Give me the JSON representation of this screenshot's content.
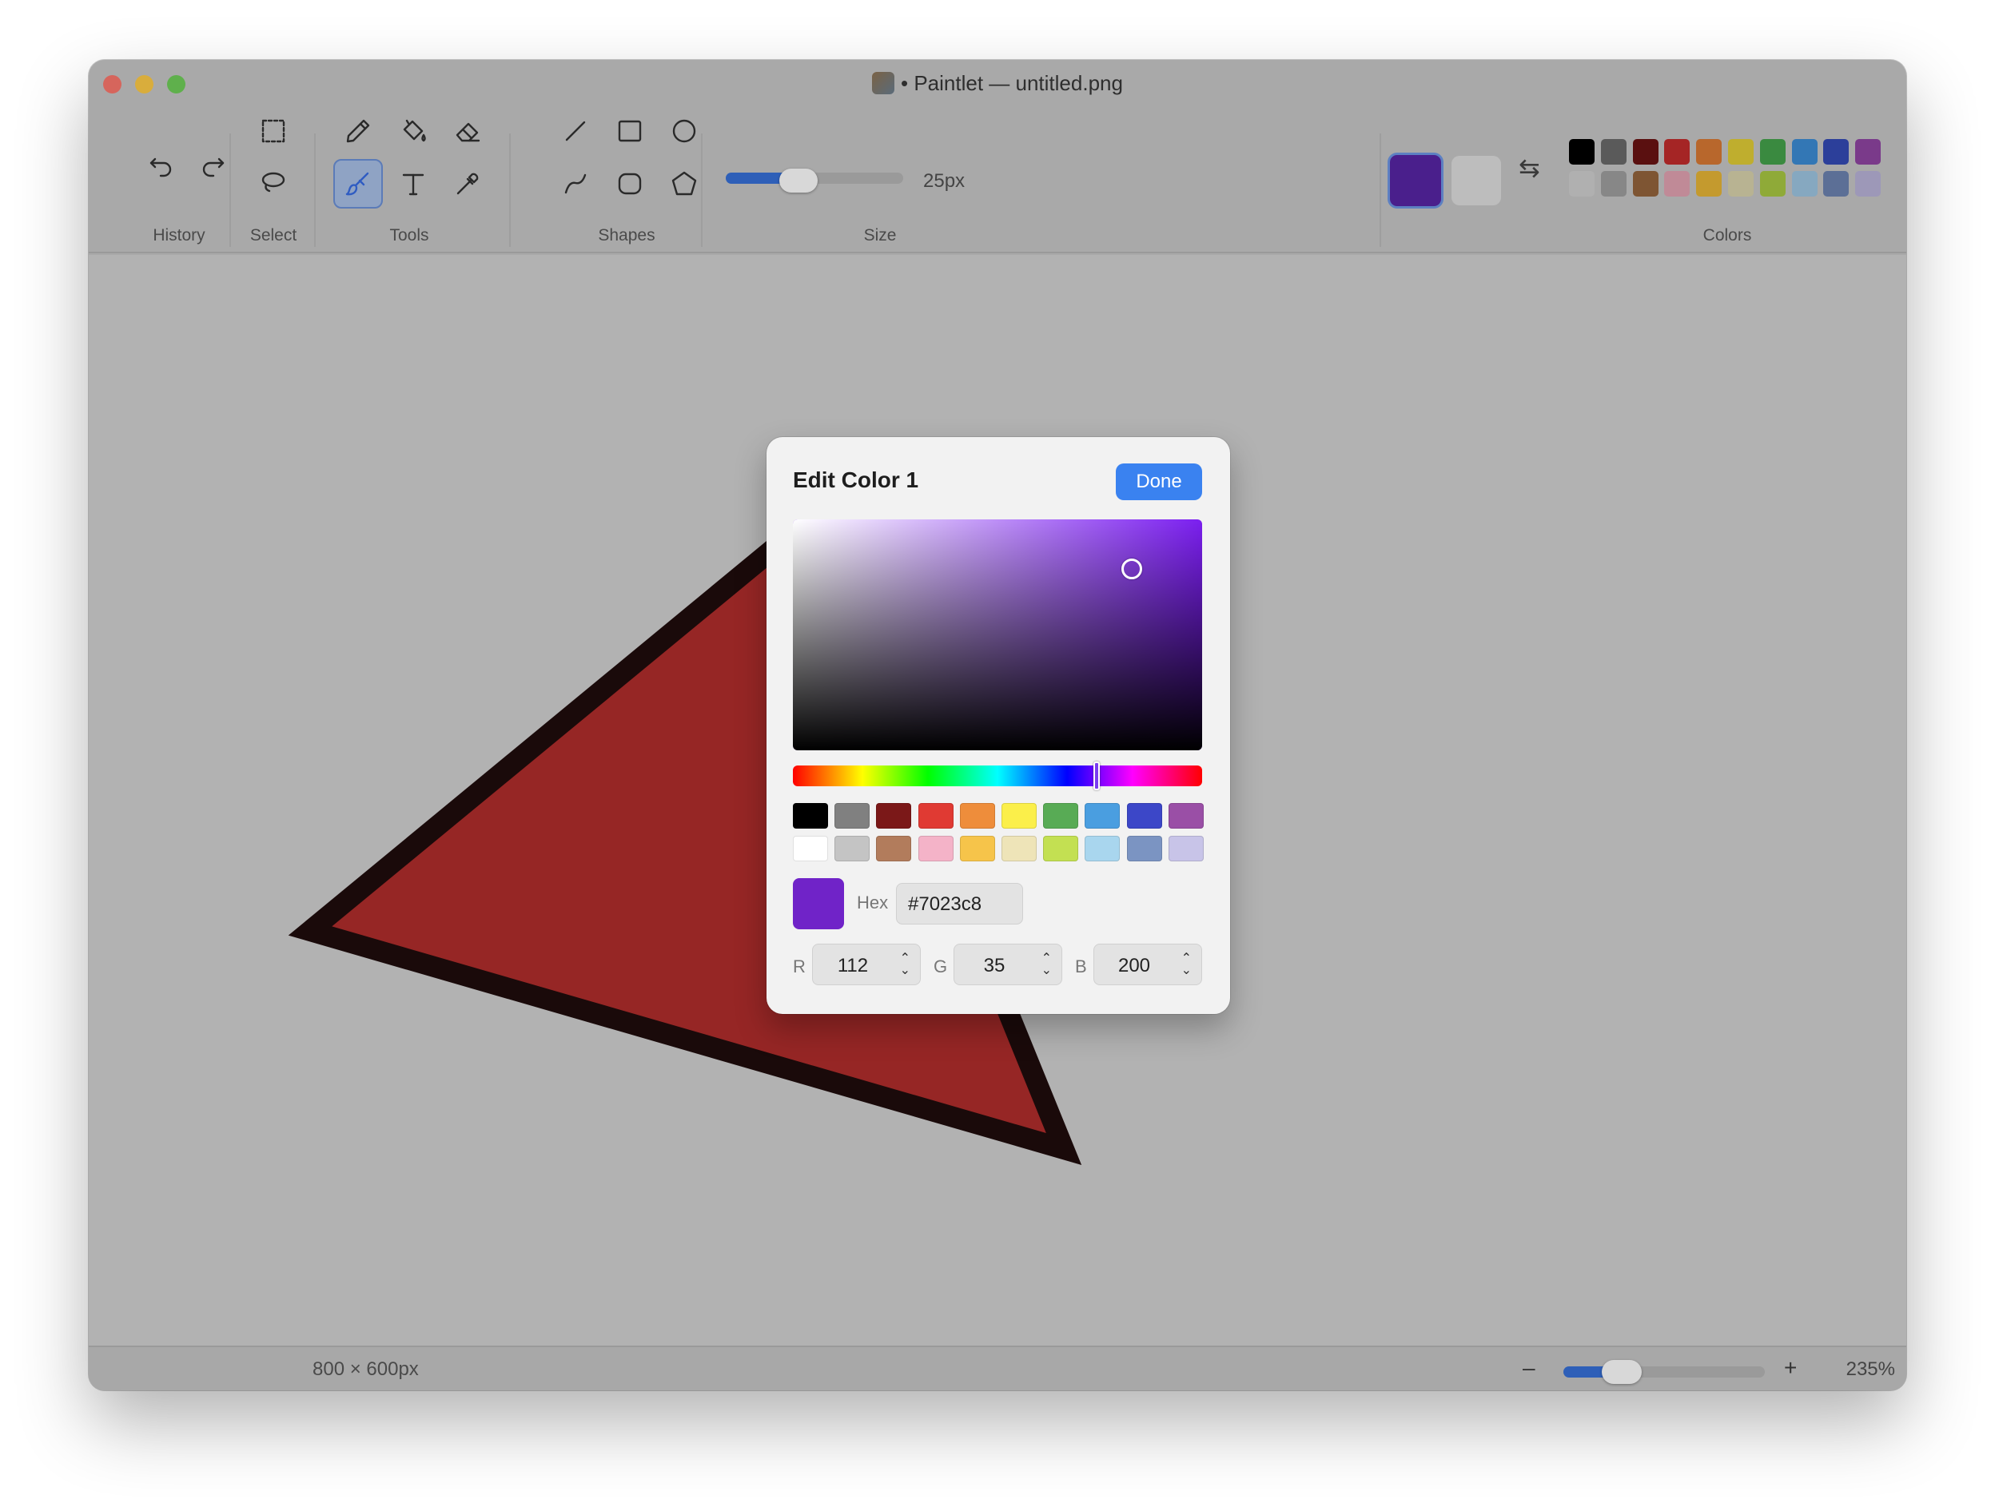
{
  "window": {
    "title": "• Paintlet — untitled.png"
  },
  "toolbar": {
    "groups": {
      "history": "History",
      "select": "Select",
      "tools": "Tools",
      "shapes": "Shapes",
      "size": "Size",
      "colors": "Colors"
    },
    "size_value": "25px",
    "size_slider_fraction": 0.3,
    "active_tool": "brush",
    "primary_color": "#4a1f8c",
    "secondary_color": "#bdbdbd",
    "palette_top": [
      "#000000",
      "#5a5a5a",
      "#5a1010",
      "#a52525",
      "#b8672c",
      "#bfae2e",
      "#3a8a40",
      "#3377b5",
      "#2c3f9a",
      "#7a3a8a"
    ],
    "palette_bottom": [
      "#b0b0b0",
      "#878787",
      "#7e5533",
      "#c08a97",
      "#c49a2e",
      "#b8b392",
      "#8faa38",
      "#86a8c0",
      "#5c6f96",
      "#9d98b8"
    ]
  },
  "canvas": {
    "shape_fill": "#962625",
    "shape_stroke": "#1a0a0a"
  },
  "status": {
    "dimensions": "800 × 600px",
    "zoom_minus": "–",
    "zoom_plus": "+",
    "zoom_level": "235%"
  },
  "color_editor": {
    "title": "Edit Color 1",
    "done_label": "Done",
    "hue_color": "#7b1ff0",
    "swatches_top": [
      "#000000",
      "#808080",
      "#7b1818",
      "#e03a33",
      "#ee8d3b",
      "#fbef4a",
      "#58ab55",
      "#4a9ee0",
      "#3c47c8",
      "#9a4fa6"
    ],
    "swatches_bottom": [
      "#ffffff",
      "#c4c4c4",
      "#b27c5c",
      "#f4b3c8",
      "#f6c44a",
      "#eee4b8",
      "#c3e052",
      "#a9d6ee",
      "#7b94c2",
      "#c8c4e8"
    ],
    "preview_color": "#7023c8",
    "hex_label": "Hex",
    "hex_value": "#7023c8",
    "r_label": "R",
    "r_value": "112",
    "g_label": "G",
    "g_value": "35",
    "b_label": "B",
    "b_value": "200"
  }
}
